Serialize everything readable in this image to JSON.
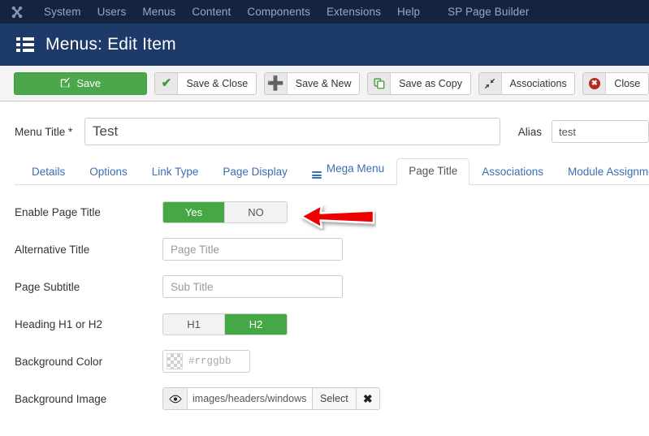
{
  "topnav": {
    "logo_icon": "joomla-logo-icon",
    "items": [
      {
        "label": "System"
      },
      {
        "label": "Users"
      },
      {
        "label": "Menus"
      },
      {
        "label": "Content"
      },
      {
        "label": "Components"
      },
      {
        "label": "Extensions"
      },
      {
        "label": "Help"
      },
      {
        "label": "SP Page Builder"
      }
    ]
  },
  "titlebar": {
    "icon": "list-icon",
    "title": "Menus: Edit Item"
  },
  "toolbar": {
    "save_label": "Save",
    "save_icon": "edit-square-icon",
    "save_close_label": "Save & Close",
    "save_close_icon": "check-icon",
    "save_new_label": "Save & New",
    "save_new_icon": "plus-icon",
    "save_copy_label": "Save as Copy",
    "save_copy_icon": "copy-icon",
    "associations_label": "Associations",
    "associations_icon": "arrows-collapse-icon",
    "close_label": "Close",
    "close_icon": "close-circle-icon"
  },
  "form": {
    "menu_title_label": "Menu Title *",
    "menu_title_value": "Test",
    "alias_label": "Alias",
    "alias_value": "test"
  },
  "tabs": [
    {
      "label": "Details",
      "active": false,
      "icon": ""
    },
    {
      "label": "Options",
      "active": false,
      "icon": ""
    },
    {
      "label": "Link Type",
      "active": false,
      "icon": ""
    },
    {
      "label": "Page Display",
      "active": false,
      "icon": ""
    },
    {
      "label": "Mega Menu",
      "active": false,
      "icon": "hamburger-icon"
    },
    {
      "label": "Page Title",
      "active": true,
      "icon": ""
    },
    {
      "label": "Associations",
      "active": false,
      "icon": ""
    },
    {
      "label": "Module Assignment",
      "active": false,
      "icon": ""
    }
  ],
  "page_title_tab": {
    "enable_page_title": {
      "label": "Enable Page Title",
      "yes_label": "Yes",
      "no_label": "NO",
      "selected": "Yes"
    },
    "alternative_title": {
      "label": "Alternative Title",
      "value": "",
      "placeholder": "Page Title"
    },
    "page_subtitle": {
      "label": "Page Subtitle",
      "value": "",
      "placeholder": "Sub Title"
    },
    "heading": {
      "label": "Heading H1 or H2",
      "h1_label": "H1",
      "h2_label": "H2",
      "selected": "H2"
    },
    "background_color": {
      "label": "Background Color",
      "value": "",
      "placeholder": "#rrggbb",
      "swatch_icon": "transparent-checker-swatch"
    },
    "background_image": {
      "label": "Background Image",
      "preview_icon": "eye-icon",
      "value": "images/headers/windows.jpg",
      "select_label": "Select",
      "clear_icon": "x-clear-icon"
    }
  },
  "annotation": {
    "arrow_icon": "red-left-arrow-annotation",
    "color": "#ee0000"
  },
  "colors": {
    "topnav_bg": "#15233f",
    "titlebar_bg": "#1e3a68",
    "toolbar_bg": "#f4f4f4",
    "accent_green": "#4ca64c",
    "toggle_green": "#45a845",
    "tab_link": "#3c6eb4",
    "danger_red": "#b42b23"
  }
}
